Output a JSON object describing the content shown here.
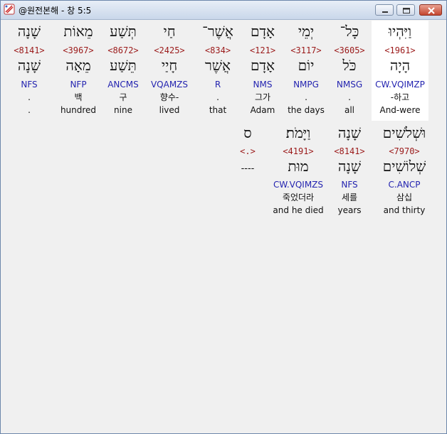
{
  "window": {
    "title": "@원전본해 - 창 5:5",
    "icons": {
      "app": "bible-app-icon",
      "minimize": "minimize-icon",
      "maximize": "maximize-icon",
      "close": "close-icon"
    }
  },
  "row1": [
    {
      "heb": "וַיִּהְיוּ",
      "strong": "<1961>",
      "lemma": "הָיָה",
      "morph": "CW.VQIMZP",
      "kor": "-하고",
      "eng": "And-were",
      "highlight": true
    },
    {
      "heb": "כָּל־",
      "strong": "<3605>",
      "lemma": "כֹּל",
      "morph": "NMSG",
      "kor": ".",
      "eng": "all"
    },
    {
      "heb": "יְמֵי",
      "strong": "<3117>",
      "lemma": "יוֹם",
      "morph": "NMPG",
      "kor": ".",
      "eng": "the days"
    },
    {
      "heb": "אָדָם",
      "strong": "<121>",
      "lemma": "אָדָם",
      "morph": "NMS",
      "kor": "그가",
      "eng": "Adam"
    },
    {
      "heb": "אֲשֶׁר־",
      "strong": "<834>",
      "lemma": "אֲשֶׁר",
      "morph": "R",
      "kor": ".",
      "eng": "that"
    },
    {
      "heb": "חַי",
      "strong": "<2425>",
      "lemma": "חָיַי",
      "morph": "VQAMZS",
      "kor": "향수-",
      "eng": "lived"
    },
    {
      "heb": "תְּשַׁע",
      "strong": "<8672>",
      "lemma": "תֵּשַׁע",
      "morph": "ANCMS",
      "kor": "구",
      "eng": "nine"
    },
    {
      "heb": "מֵאוֹת",
      "strong": "<3967>",
      "lemma": "מֵאָה",
      "morph": "NFP",
      "kor": "백",
      "eng": "hundred"
    },
    {
      "heb": "שָׁנָה",
      "strong": "<8141>",
      "lemma": "שָׁנָה",
      "morph": "NFS",
      "kor": ".",
      "eng": "."
    }
  ],
  "row2": [
    {
      "heb": "וּשְׁלֹשִׁים",
      "strong": "<7970>",
      "lemma": "שְׁלוֹשִׁים",
      "morph": "C.ANCP",
      "kor": "삼십",
      "eng": "and thirty"
    },
    {
      "heb": "שָׁנָה",
      "strong": "<8141>",
      "lemma": "שָׁנָה",
      "morph": "NFS",
      "kor": "세를",
      "eng": "years"
    },
    {
      "heb": "וַיָּמֹת׃",
      "strong": "<4191>",
      "lemma": "מוּת",
      "morph": "CW.VQIMZS",
      "kor": "죽었더라",
      "eng": "and he died"
    },
    {
      "heb": "ס",
      "strong": "<.>",
      "lemma": "----",
      "morph": "",
      "kor": "",
      "eng": ""
    }
  ]
}
